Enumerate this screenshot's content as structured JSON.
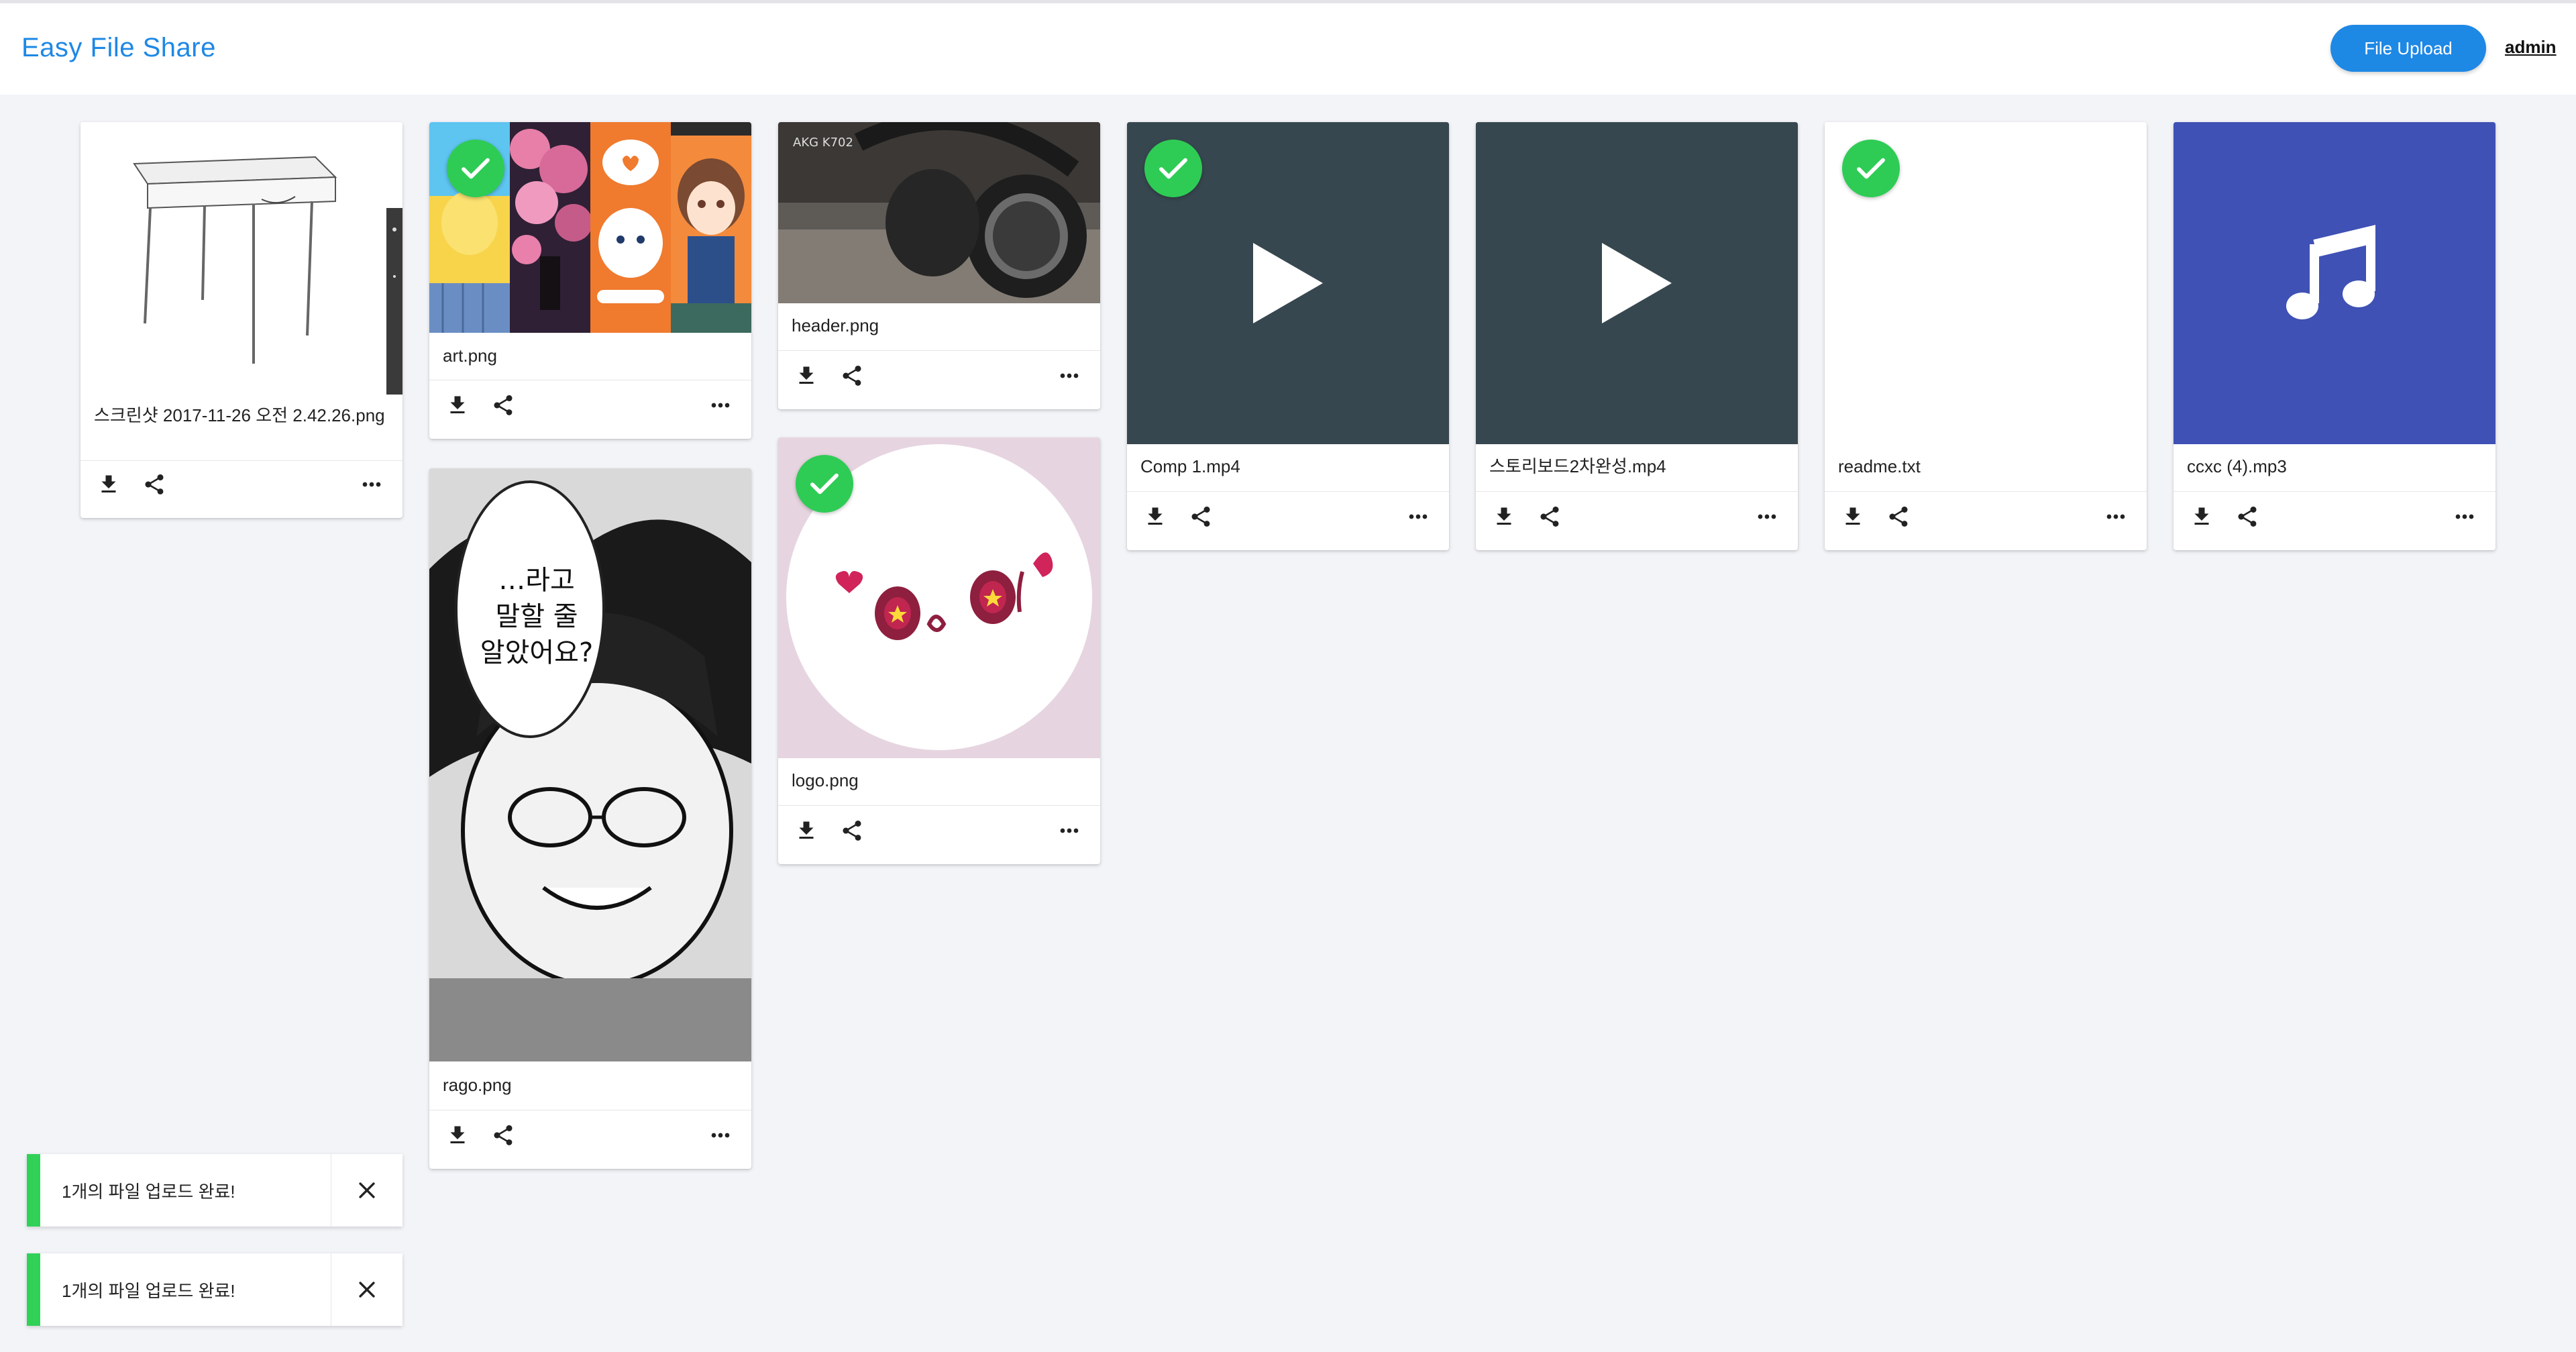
{
  "app": {
    "title": "Easy File Share"
  },
  "header": {
    "upload_label": "File Upload",
    "user_label": "admin"
  },
  "files": [
    {
      "name": "스크린샷 2017-11-26 오전 2.42.26.png",
      "thumbnail": "desk-sketch",
      "uploaded": false
    },
    {
      "name": "art.png",
      "thumbnail": "anime-collage",
      "uploaded": true
    },
    {
      "name": "rago.png",
      "thumbnail": "manga-panel",
      "uploaded": false,
      "thumbnail_text": [
        "…라고",
        "말할 줄",
        "알았어요?"
      ]
    },
    {
      "name": "header.png",
      "thumbnail": "headphones-photo",
      "uploaded": false,
      "thumbnail_text": [
        "AKG K702"
      ]
    },
    {
      "name": "logo.png",
      "thumbnail": "logo-eyes",
      "uploaded": true
    },
    {
      "name": "Comp 1.mp4",
      "thumbnail": "video-play-icon",
      "uploaded": true
    },
    {
      "name": "스토리보드2차완성.mp4",
      "thumbnail": "video-play-icon",
      "uploaded": false
    },
    {
      "name": "readme.txt",
      "thumbnail": "text-blank",
      "uploaded": true
    },
    {
      "name": "ccxc (4).mp3",
      "thumbnail": "music-note-icon",
      "uploaded": false
    }
  ],
  "actions": {
    "download_icon": "download-icon",
    "share_icon": "share-icon",
    "more_icon": "more-horiz-icon"
  },
  "toasts": [
    {
      "message": "1개의 파일 업로드 완료!"
    },
    {
      "message": "1개의 파일 업로드 완료!"
    }
  ],
  "colors": {
    "brand": "#1e88e5",
    "success": "#2ecc55",
    "video_bg": "#37474f",
    "audio_bg": "#3f51b5",
    "page_bg": "#f3f4f8"
  }
}
